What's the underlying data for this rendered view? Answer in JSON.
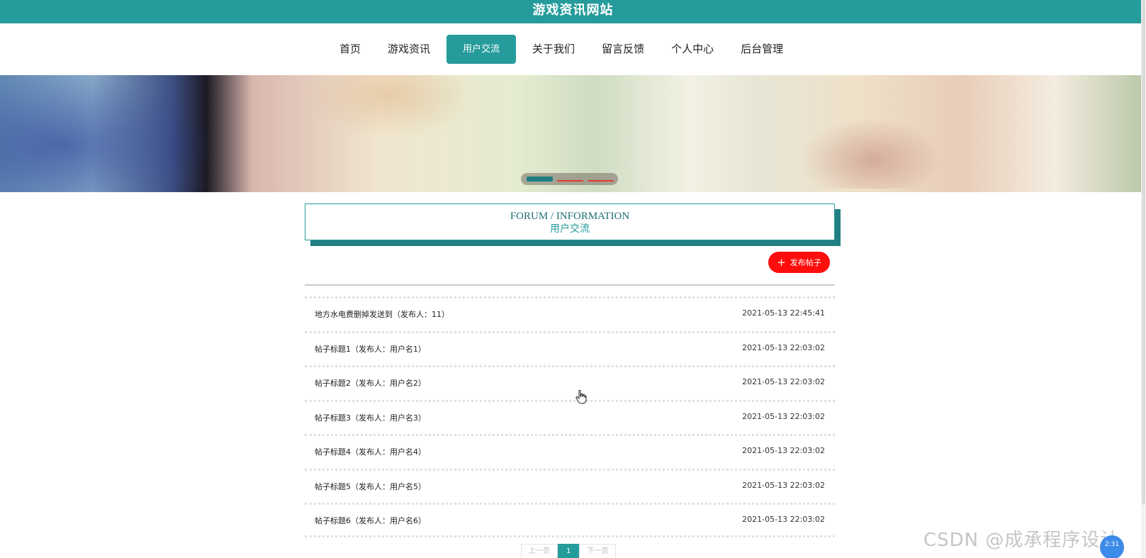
{
  "header": {
    "site_title": "游戏资讯网站"
  },
  "nav": {
    "items": [
      {
        "label": "首页",
        "active": false
      },
      {
        "label": "游戏资讯",
        "active": false
      },
      {
        "label": "用户交流",
        "active": true
      },
      {
        "label": "关于我们",
        "active": false
      },
      {
        "label": "留言反馈",
        "active": false
      },
      {
        "label": "个人中心",
        "active": false
      },
      {
        "label": "后台管理",
        "active": false
      }
    ]
  },
  "section": {
    "title_en": "FORUM / INFORMATION",
    "title_zh": "用户交流"
  },
  "actions": {
    "publish_label": "发布帖子",
    "publish_icon": "+"
  },
  "posts": [
    {
      "title": "地方水电费删掉发送到（发布人：11）",
      "time": "2021-05-13 22:45:41"
    },
    {
      "title": "帖子标题1（发布人：用户名1）",
      "time": "2021-05-13 22:03:02"
    },
    {
      "title": "帖子标题2（发布人：用户名2）",
      "time": "2021-05-13 22:03:02"
    },
    {
      "title": "帖子标题3（发布人：用户名3）",
      "time": "2021-05-13 22:03:02"
    },
    {
      "title": "帖子标题4（发布人：用户名4）",
      "time": "2021-05-13 22:03:02"
    },
    {
      "title": "帖子标题5（发布人：用户名5）",
      "time": "2021-05-13 22:03:02"
    },
    {
      "title": "帖子标题6（发布人：用户名6）",
      "time": "2021-05-13 22:03:02"
    }
  ],
  "pagination": {
    "prev_label": "上一页",
    "current_page": "1",
    "next_label": "下一页"
  },
  "overlay": {
    "watermark": "CSDN @成承程序设计",
    "badge_text": "2:31"
  },
  "colors": {
    "primary": "#259b9b",
    "publish_button": "#ff0c0c",
    "carousel_active": "#1d7d80",
    "carousel_inactive": "#e23b2e"
  }
}
